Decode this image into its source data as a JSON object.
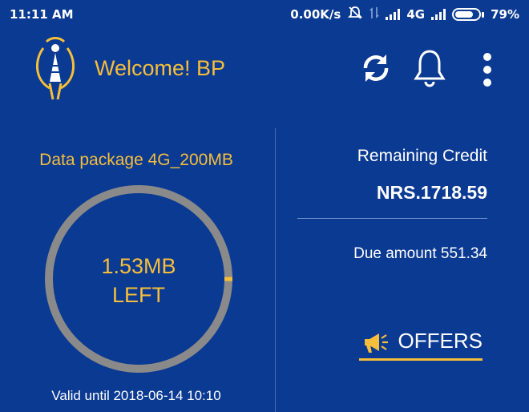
{
  "status_bar": {
    "time": "11:11 AM",
    "net_speed": "0.00K/s",
    "network": "4G",
    "battery": "79%",
    "battery_level": 0.79,
    "icons": [
      "mute-icon",
      "data-arrows-icon",
      "signal-icon",
      "signal-icon",
      "battery-icon"
    ]
  },
  "header": {
    "welcome": "Welcome! BP",
    "icons": [
      "ntc-logo",
      "refresh-icon",
      "bell-icon",
      "more-vert-icon"
    ]
  },
  "package": {
    "title": "Data package 4G_200MB",
    "remaining_amount": "1.53MB",
    "remaining_label": "LEFT",
    "remaining_fraction": 0.0077,
    "valid_until": "Valid  until 2018-06-14 10:10"
  },
  "account": {
    "credit_label": "Remaining Credit",
    "credit_value": "NRS.1718.59",
    "due": "Due amount  551.34"
  },
  "offers": {
    "label": "OFFERS",
    "icon": "megaphone-icon"
  },
  "colors": {
    "background": "#0b3a93",
    "accent": "#f6be3a",
    "ring_track": "#8a8a8a",
    "text": "#ffffff"
  }
}
